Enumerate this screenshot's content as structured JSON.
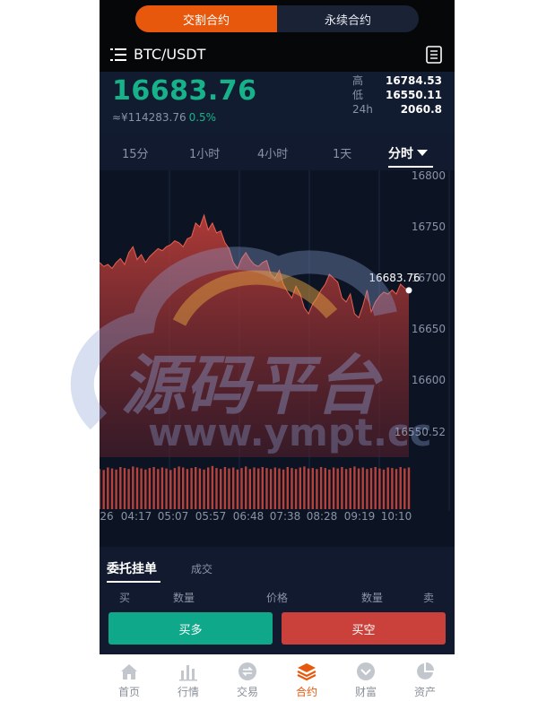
{
  "contract_tabs": [
    "交割合约",
    "永续合约"
  ],
  "symbol": "BTC/USDT",
  "last_price": "16683.76",
  "cny_price": "≈¥114283.76",
  "change_pct": "0.5%",
  "stats": [
    {
      "label": "高",
      "value": "16784.53"
    },
    {
      "label": "低",
      "value": "16550.11"
    },
    {
      "label": "24h",
      "value": "2060.8"
    }
  ],
  "intervals": [
    "15分",
    "1小时",
    "4小时",
    "1天",
    "分时"
  ],
  "active_interval": "分时",
  "chart_data": {
    "type": "area",
    "y_ticks": [
      "16800",
      "16750",
      "16700",
      "16650",
      "16600",
      "16550.52"
    ],
    "ylim": [
      16540,
      16800
    ],
    "x_ticks": [
      "26",
      "04:17",
      "05:07",
      "05:57",
      "06:48",
      "07:38",
      "08:28",
      "09:19",
      "10:10"
    ],
    "last_value_label": "16683.76",
    "values": [
      16712,
      16708,
      16710,
      16706,
      16712,
      16716,
      16710,
      16722,
      16728,
      16715,
      16720,
      16712,
      16718,
      16722,
      16726,
      16724,
      16728,
      16730,
      16734,
      16732,
      16728,
      16736,
      16738,
      16752,
      16748,
      16760,
      16745,
      16752,
      16742,
      16744,
      16732,
      16726,
      16712,
      16706,
      16716,
      16722,
      16715,
      16710,
      16708,
      16712,
      16714,
      16700,
      16696,
      16704,
      16690,
      16682,
      16676,
      16688,
      16680,
      16666,
      16660,
      16670,
      16676,
      16684,
      16690,
      16700,
      16696,
      16692,
      16676,
      16672,
      16680,
      16660,
      16656,
      16668,
      16684,
      16662,
      16672,
      16678,
      16682,
      16680,
      16684,
      16680,
      16690,
      16686,
      16683.76
    ],
    "volume": [
      0.8,
      0.78,
      0.83,
      0.81,
      0.79,
      0.84,
      0.82,
      0.8,
      0.85,
      0.83,
      0.81,
      0.79,
      0.82,
      0.84,
      0.8,
      0.83,
      0.81,
      0.78,
      0.82,
      0.85,
      0.83,
      0.8,
      0.82,
      0.84,
      0.81,
      0.79,
      0.83,
      0.86,
      0.82,
      0.8,
      0.84,
      0.81,
      0.83,
      0.79,
      0.82,
      0.85,
      0.8,
      0.83,
      0.81,
      0.84,
      0.82,
      0.8,
      0.83,
      0.81,
      0.79,
      0.84,
      0.82,
      0.8,
      0.83,
      0.85,
      0.81,
      0.82,
      0.8,
      0.84,
      0.82,
      0.79,
      0.83,
      0.81,
      0.84,
      0.8,
      0.82,
      0.85,
      0.81,
      0.83,
      0.8,
      0.82,
      0.84,
      0.81,
      0.79,
      0.83,
      0.82,
      0.8,
      0.84,
      0.81,
      0.83
    ]
  },
  "orders": {
    "tab_active": "委托挂单",
    "tab_other": "成交",
    "headers": [
      "买",
      "数量",
      "价格",
      "数量",
      "卖"
    ]
  },
  "actions": {
    "buy": "买多",
    "sell": "买空"
  },
  "bottom_nav": [
    {
      "label": "首页",
      "icon": "home-icon"
    },
    {
      "label": "行情",
      "icon": "bar-chart-icon"
    },
    {
      "label": "交易",
      "icon": "exchange-icon"
    },
    {
      "label": "合约",
      "icon": "layers-icon"
    },
    {
      "label": "财富",
      "icon": "wallet-icon"
    },
    {
      "label": "资产",
      "icon": "pie-icon"
    }
  ],
  "active_nav": "合约",
  "watermark": {
    "title": "源码平台",
    "url": "www.ympt.cc"
  },
  "colors": {
    "accent": "#e8580c",
    "up": "#16b38a",
    "down": "#c9413a",
    "bg": "#111a2e"
  }
}
